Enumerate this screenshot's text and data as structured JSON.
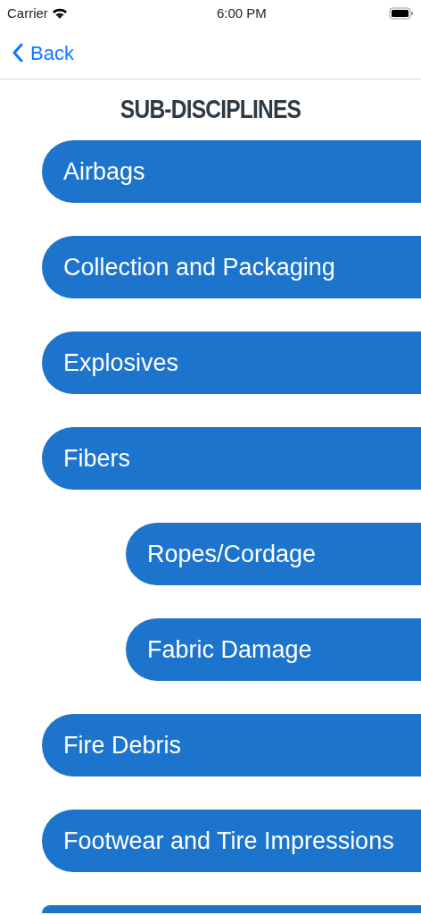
{
  "status_bar": {
    "carrier": "Carrier",
    "time": "6:00 PM"
  },
  "nav_bar": {
    "back_label": "Back"
  },
  "title": "SUB-DISCIPLINES",
  "items": [
    {
      "label": "Airbags"
    },
    {
      "label": "Collection and Packaging"
    },
    {
      "label": "Explosives"
    },
    {
      "label": "Fibers",
      "children": [
        {
          "label": "Ropes/Cordage"
        },
        {
          "label": "Fabric Damage"
        }
      ]
    },
    {
      "label": "Fire Debris"
    },
    {
      "label": "Footwear and Tire Impressions"
    },
    {
      "cut_off": true
    }
  ]
}
